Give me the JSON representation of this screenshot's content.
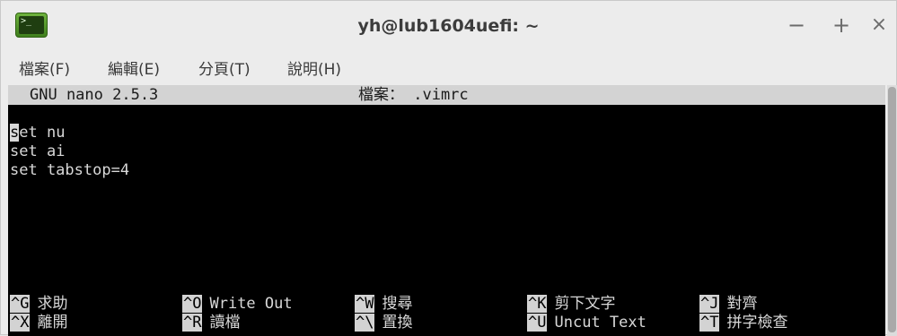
{
  "window": {
    "title": "yh@lub1604uefi: ~",
    "icon": "terminal-icon",
    "icon_prompt": ">_",
    "controls": {
      "minimize": "−",
      "maximize": "+",
      "close": "×"
    }
  },
  "menu": [
    "檔案(F)",
    "編輯(E)",
    "分頁(T)",
    "說明(H)"
  ],
  "nano": {
    "version": "GNU nano 2.5.3",
    "file_label": "檔案： .vimrc"
  },
  "content": {
    "cursor_char": "s",
    "lines": [
      "et nu",
      "set ai",
      "set tabstop=4"
    ]
  },
  "shortcuts": {
    "row1": [
      {
        "key": "^G",
        "label": "求助"
      },
      {
        "key": "^O",
        "label": "Write Out"
      },
      {
        "key": "^W",
        "label": "搜尋"
      },
      {
        "key": "^K",
        "label": "剪下文字"
      },
      {
        "key": "^J",
        "label": "對齊"
      }
    ],
    "row2": [
      {
        "key": "^X",
        "label": "離開"
      },
      {
        "key": "^R",
        "label": "讀檔"
      },
      {
        "key": "^\\",
        "label": "置換"
      },
      {
        "key": "^U",
        "label": "Uncut Text"
      },
      {
        "key": "^T",
        "label": "拼字檢查"
      }
    ]
  }
}
